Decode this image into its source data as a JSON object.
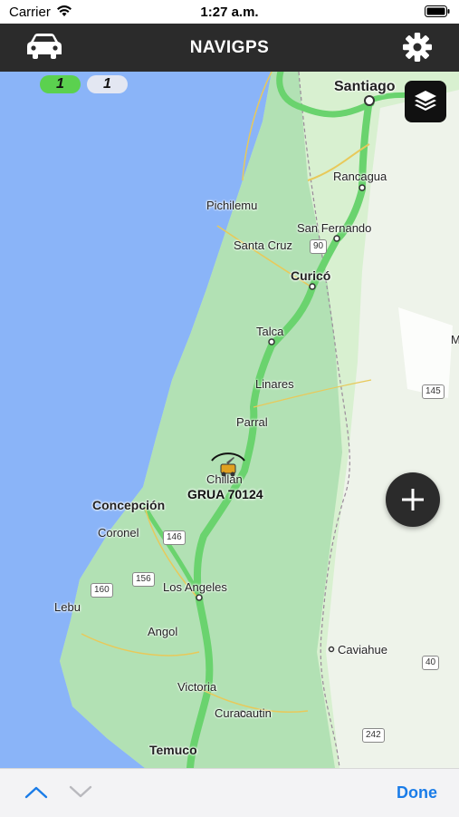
{
  "status_bar": {
    "carrier": "Carrier",
    "time": "1:27 a.m."
  },
  "header": {
    "title": "NAVIGPS",
    "left_icon": "car-icon",
    "right_icon": "gear-icon"
  },
  "counters": {
    "green": "1",
    "gray": "1"
  },
  "map": {
    "cities": [
      {
        "id": "santiago",
        "name": "Santiago"
      },
      {
        "id": "rancagua",
        "name": "Rancagua"
      },
      {
        "id": "pichilemu",
        "name": "Pichilemu"
      },
      {
        "id": "san-fernando",
        "name": "San Fernando"
      },
      {
        "id": "santa-cruz",
        "name": "Santa Cruz"
      },
      {
        "id": "curico",
        "name": "Curicó"
      },
      {
        "id": "talca",
        "name": "Talca"
      },
      {
        "id": "linares",
        "name": "Linares"
      },
      {
        "id": "parral",
        "name": "Parral"
      },
      {
        "id": "chillan",
        "name": "Chillán"
      },
      {
        "id": "concepcion",
        "name": "Concepción"
      },
      {
        "id": "coronel",
        "name": "Coronel"
      },
      {
        "id": "los-angeles",
        "name": "Los Angeles"
      },
      {
        "id": "lebu",
        "name": "Lebu"
      },
      {
        "id": "angol",
        "name": "Angol"
      },
      {
        "id": "victoria",
        "name": "Victoria"
      },
      {
        "id": "curacautin",
        "name": "Curacautin"
      },
      {
        "id": "temuco",
        "name": "Temuco"
      },
      {
        "id": "caviahue",
        "name": "Caviahue"
      },
      {
        "id": "m",
        "name": "M"
      }
    ],
    "shields": [
      {
        "id": "r90",
        "label": "90"
      },
      {
        "id": "r145",
        "label": "145"
      },
      {
        "id": "r146",
        "label": "146"
      },
      {
        "id": "r156",
        "label": "156"
      },
      {
        "id": "r160",
        "label": "160"
      },
      {
        "id": "r40",
        "label": "40"
      },
      {
        "id": "r242",
        "label": "242"
      }
    ],
    "vehicle_label": "GRUA 70124",
    "colors": {
      "water": "#8ab4f8",
      "land": "#d8f0d0",
      "forest": "#a5dcab",
      "route": "#6ad36e"
    }
  },
  "toolbar": {
    "done_label": "Done",
    "up_icon": "chevron-up-icon",
    "down_icon": "chevron-down-icon"
  }
}
